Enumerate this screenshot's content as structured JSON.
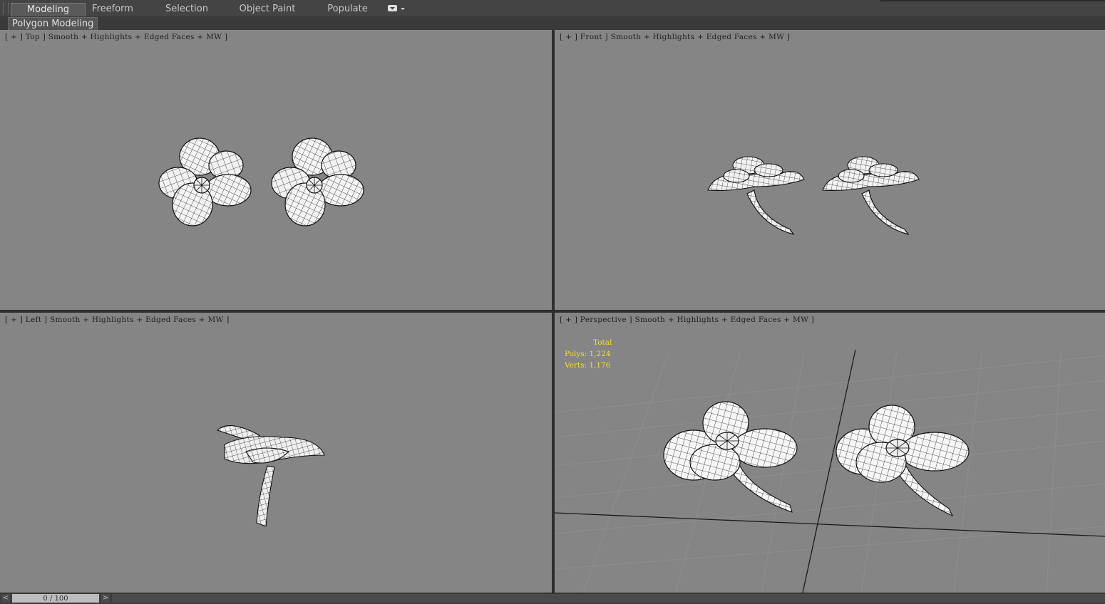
{
  "ribbon": {
    "tabs": [
      {
        "label": "Modeling",
        "active": true
      },
      {
        "label": "Freeform",
        "active": false
      },
      {
        "label": "Selection",
        "active": false
      },
      {
        "label": "Object Paint",
        "active": false
      },
      {
        "label": "Populate",
        "active": false
      }
    ],
    "dropdown_icon": "dropdown-arrow-icon"
  },
  "panel": {
    "label": "Polygon Modeling"
  },
  "viewports": {
    "top": {
      "label": "[ + ] Top ] Smooth + Highlights + Edged Faces + MW ]"
    },
    "front": {
      "label": "[ + ] Front ] Smooth + Highlights + Edged Faces + MW ]"
    },
    "left": {
      "label": "[ + ] Left ] Smooth + Highlights + Edged Faces + MW ]"
    },
    "perspective": {
      "label": "[ + ] Perspective ] Smooth + Highlights + Edged Faces + MW ]",
      "stats": {
        "title": "Total",
        "polys": "Polys: 1,224",
        "verts": "Verts: 1,176"
      }
    }
  },
  "timeline": {
    "slider_text": "0 / 100",
    "prev_icon": "<",
    "next_icon": ">"
  },
  "colors": {
    "viewport_bg": "#858585",
    "stats_text": "#f0e020",
    "ui_dark": "#3c3c3c"
  }
}
